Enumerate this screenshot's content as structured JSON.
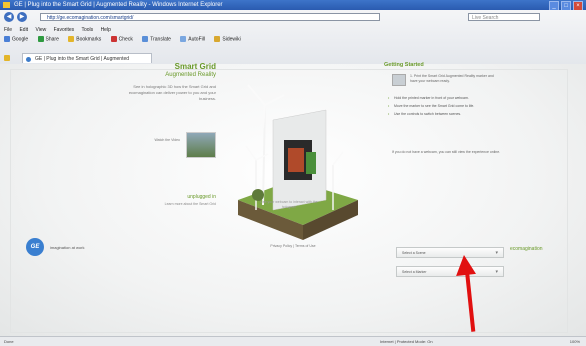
{
  "window": {
    "title": "GE | Plug into the Smart Grid | Augmented Reality - Windows Internet Explorer"
  },
  "browser": {
    "address": "http://ge.ecomagination.com/smartgrid/",
    "search_placeholder": "Live Search",
    "menu": [
      "File",
      "Edit",
      "View",
      "Favorites",
      "Tools",
      "Help"
    ],
    "toolbar": [
      "Google",
      "Share",
      "Bookmarks",
      "Check",
      "Translate",
      "AutoFill",
      "Sidewiki"
    ],
    "tab_label": "GE | Plug into the Smart Grid | Augmented"
  },
  "page": {
    "heading": "Smart Grid",
    "subheading": "Augmented Reality",
    "intro": "See in holographic 3D how the Smart Grid and ecomagination can deliver power to you and your business.",
    "thumb_text": "Watch the Video",
    "link_label": "unplugged in",
    "link_sub": "Learn more about the Smart Grid",
    "caption": "Use your webcam to interact with the hologram",
    "footer_text": "Privacy Policy | Terms of Use",
    "ge_logo": "GE",
    "ge_tagline": "imagination at work",
    "eco_logo": "ecomagination"
  },
  "right_panel": {
    "title": "Getting Started",
    "lead": "1. Print the Smart Grid Augmented Reality marker and have your webcam ready.",
    "bullets": [
      "Hold the printed marker in front of your webcam.",
      "Move the marker to see the Smart Grid come to life.",
      "Use the controls to switch between scenes."
    ],
    "note": "If you do not have a webcam, you can still view the experience online.",
    "dropdown1": "Select a Scene",
    "dropdown2": "Select a Marker"
  },
  "status": {
    "left": "Done",
    "right": "Internet | Protected Mode: On",
    "zoom": "100%"
  },
  "colors": {
    "accent_green": "#6a9a2a",
    "ge_blue": "#3a7fd0",
    "arrow_red": "#e11010",
    "titlebar": "#2a5bb0"
  }
}
